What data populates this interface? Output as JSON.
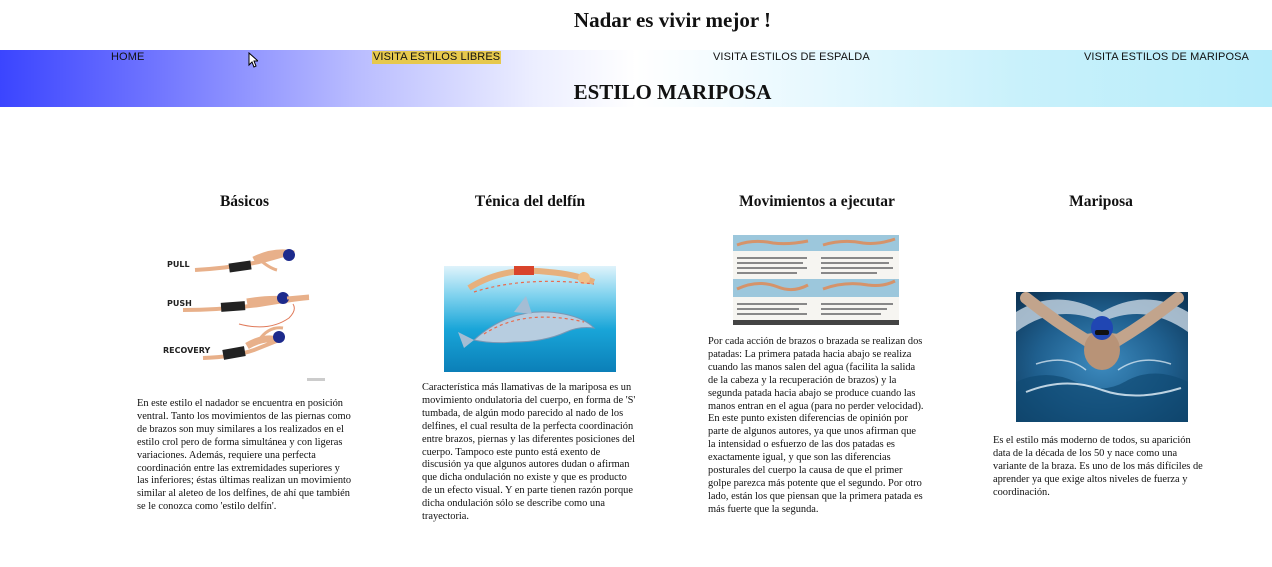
{
  "site": {
    "title": "Nadar es vivir mejor !"
  },
  "nav": {
    "home": "HOME",
    "libres": "VISITA ESTILOS LIBRES",
    "espalda": "VISITA ESTILOS DE ESPALDA",
    "mariposa": "VISITA ESTILOS DE MARIPOSA",
    "highlight_color": "#e6c84d"
  },
  "page": {
    "heading": "ESTILO MARIPOSA"
  },
  "columns": [
    {
      "title": "Básicos",
      "image_labels": [
        "PULL",
        "PUSH",
        "RECOVERY"
      ],
      "text": "En este estilo el nadador se encuentra en posición ventral. Tanto los movimientos de las piernas como de brazos son muy similares a los realizados en el estilo crol pero de forma simultánea y con ligeras variaciones. Además, requiere una perfecta coordinación entre las extremidades superiores y las inferiores; éstas últimas realizan un movimiento similar al aleteo de los delfines, de ahí que también se le conozca como 'estilo delfín'."
    },
    {
      "title": "Ténica del delfín",
      "text": "Característica más llamativas de la mariposa es un movimiento ondulatoria del cuerpo, en forma de 'S' tumbada, de algún modo parecido al nado de los delfines, el cual resulta de la perfecta coordinación entre brazos, piernas y las diferentes posiciones del cuerpo. Tampoco este punto está exento de discusión ya que algunos autores dudan o afirman que dicha ondulación no existe y que es producto de un efecto visual. Y en parte tienen razón porque dicha ondulación sólo se describe como una trayectoria."
    },
    {
      "title": "Movimientos a ejecutar",
      "text": "Por cada acción de brazos o brazada se realizan dos patadas: La primera patada hacia abajo se realiza cuando las manos salen del agua (facilita la salida de la cabeza y la recuperación de brazos) y la segunda patada hacia abajo se produce cuando las manos entran en el agua (para no perder velocidad). En este punto existen diferencias de opinión por parte de algunos autores, ya que unos afirman que la intensidad o esfuerzo de las dos patadas es exactamente igual, y que son las diferencias posturales del cuerpo la causa de que el primer golpe parezca más potente que el segundo. Por otro lado, están los que piensan que la primera patada es más fuerte que la segunda."
    },
    {
      "title": "Mariposa",
      "text": "Es el estilo más moderno de todos, su aparición data de la década de los 50 y nace como una variante de la braza. Es uno de los más difíciles de aprender ya que exige altos niveles de fuerza y coordinación."
    }
  ]
}
